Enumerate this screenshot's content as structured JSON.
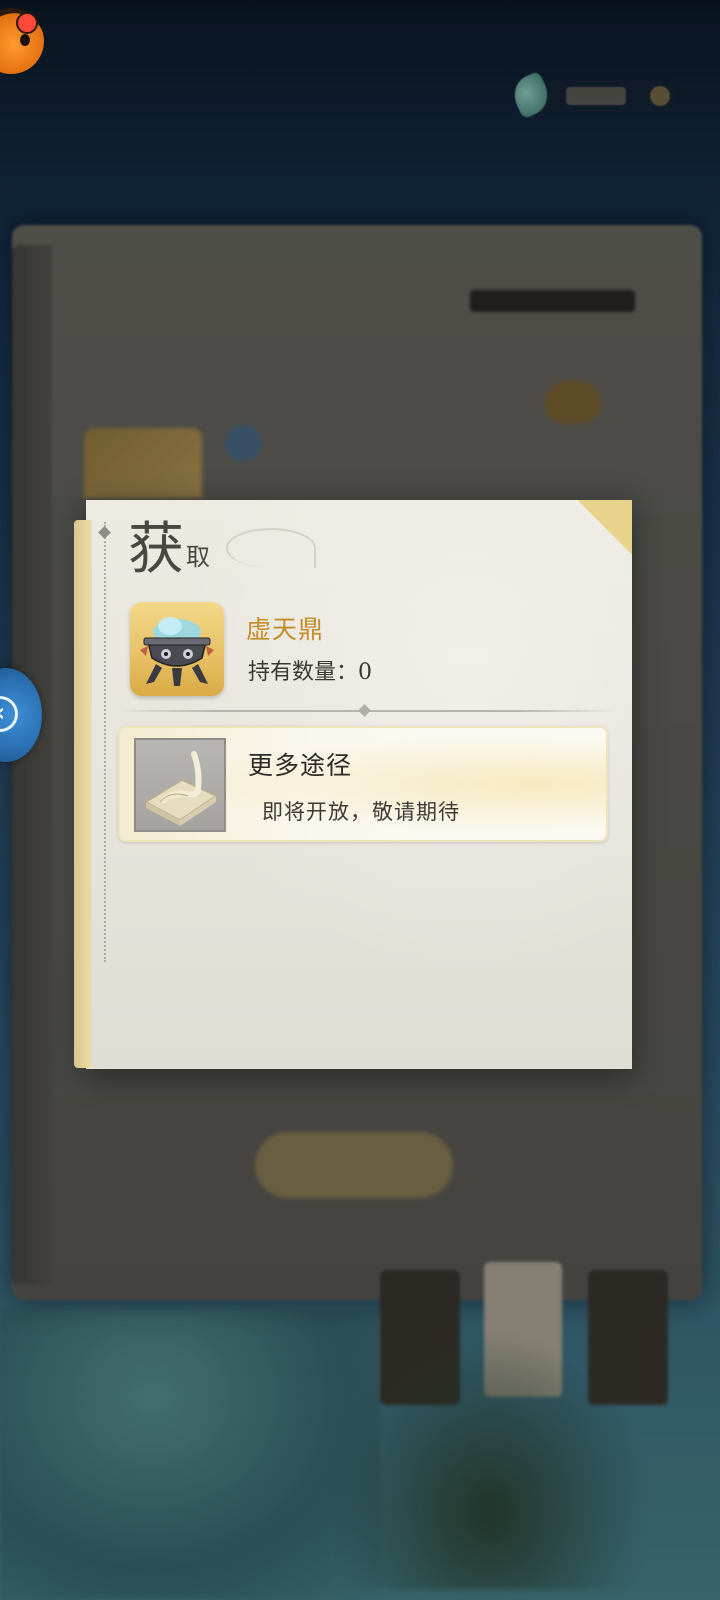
{
  "popup": {
    "title_big": "获",
    "title_small": "取",
    "item": {
      "name": "虚天鼎",
      "count_label": "持有数量：",
      "count_value": "0",
      "icon": "cauldron-icon"
    },
    "route": {
      "title": "更多途径",
      "description": "即将开放，敬请期待",
      "icon": "brush-scroll-icon"
    }
  },
  "topbar": {
    "app_icon": "mascot-icon",
    "currency_icon": "leaf-icon"
  },
  "side": {
    "back_icon": "chevron-left-icon"
  },
  "colors": {
    "item_name": "#c48d2a",
    "item_frame": "#e8c266",
    "popup_bg": "#e8e6dd"
  }
}
